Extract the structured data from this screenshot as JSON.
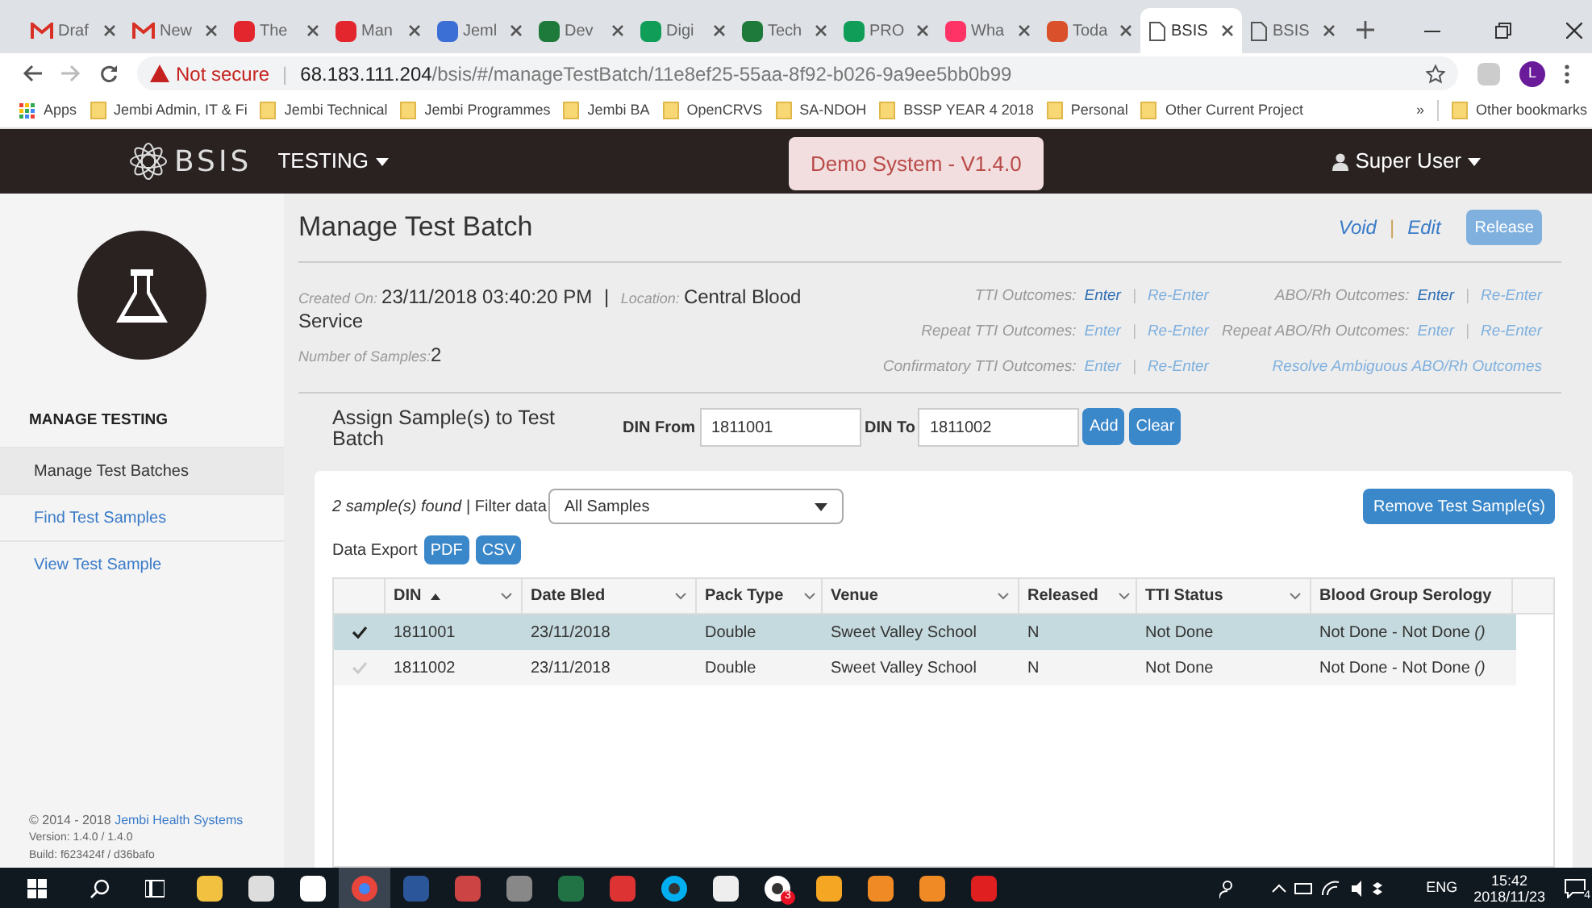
{
  "browser": {
    "tabs": [
      {
        "label": "Draf",
        "kind": "gmail",
        "selected": false
      },
      {
        "label": "New",
        "kind": "gmail",
        "selected": false
      },
      {
        "label": "The",
        "kind": "ag",
        "selected": false
      },
      {
        "label": "Man",
        "kind": "ag",
        "selected": false
      },
      {
        "label": "Jeml",
        "kind": "calendar",
        "selected": false
      },
      {
        "label": "Dev",
        "kind": "leaf",
        "selected": false
      },
      {
        "label": "Digi",
        "kind": "sheets",
        "selected": false
      },
      {
        "label": "Tech",
        "kind": "leaf",
        "selected": false
      },
      {
        "label": "PRO",
        "kind": "sheets",
        "selected": false
      },
      {
        "label": "Wha",
        "kind": "invision",
        "selected": false
      },
      {
        "label": "Toda",
        "kind": "todo",
        "selected": false
      },
      {
        "label": "BSIS",
        "kind": "page",
        "selected": true
      },
      {
        "label": "BSIS",
        "kind": "page",
        "selected": false
      }
    ],
    "address": {
      "warning": "Not secure",
      "separator": "|",
      "host": "68.183.111.204",
      "path": "/bsis/#/manageTestBatch/11e8ef25-55aa-8f92-b026-9a9ee5bb0b99"
    },
    "profile": "L",
    "bookmarks": [
      {
        "label": "Apps",
        "kind": "apps"
      },
      {
        "label": "Jembi Admin, IT & Fi",
        "kind": "folder"
      },
      {
        "label": "Jembi Technical",
        "kind": "folder"
      },
      {
        "label": "Jembi Programmes",
        "kind": "folder"
      },
      {
        "label": "Jembi BA",
        "kind": "folder"
      },
      {
        "label": "OpenCRVS",
        "kind": "folder"
      },
      {
        "label": "SA-NDOH",
        "kind": "folder"
      },
      {
        "label": "BSSP YEAR 4 2018",
        "kind": "folder"
      },
      {
        "label": "Personal",
        "kind": "folder"
      },
      {
        "label": "Other Current Project",
        "kind": "folder"
      }
    ],
    "bookmarks_more": "»",
    "other_bookmarks": "Other bookmarks"
  },
  "header": {
    "logo": "BSIS",
    "menu": "TESTING",
    "demo": "Demo System - V1.4.0",
    "user": "Super User"
  },
  "sidebar": {
    "section": "MANAGE TESTING",
    "items": [
      {
        "label": "Manage Test Batches",
        "selected": true
      },
      {
        "label": "Find Test Samples",
        "selected": false
      },
      {
        "label": "View Test Sample",
        "selected": false
      }
    ],
    "footer": {
      "copyright": "© 2014 - 2018",
      "company": "Jembi Health Systems",
      "version": "Version: 1.4.0 / 1.4.0",
      "build": "Build: f623424f / d36bafo"
    }
  },
  "page": {
    "title": "Manage Test Batch",
    "actions": {
      "void": "Void",
      "separator": "|",
      "edit": "Edit",
      "release": {
        "label": "Release",
        "disabled": true
      }
    },
    "meta": {
      "created_label": "Created On:",
      "created": "23/11/2018 03:40:20 PM",
      "separator": "|",
      "location_label": "Location:",
      "location": "Central Blood Service",
      "samples_label": "Number of Samples:",
      "samples": "2"
    },
    "outcomes": [
      {
        "label": "TTI Outcomes:",
        "separator": "|",
        "links": [
          {
            "label": "Enter",
            "enabled": true
          },
          {
            "label": "Re-Enter",
            "enabled": false
          }
        ]
      },
      {
        "label": "ABO/Rh Outcomes:",
        "separator": "|",
        "links": [
          {
            "label": "Enter",
            "enabled": true
          },
          {
            "label": "Re-Enter",
            "enabled": false
          }
        ]
      },
      {
        "label": "Repeat TTI Outcomes:",
        "separator": "|",
        "links": [
          {
            "label": "Enter",
            "enabled": false
          },
          {
            "label": "Re-Enter",
            "enabled": false
          }
        ]
      },
      {
        "label": "Repeat ABO/Rh Outcomes:",
        "separator": "|",
        "links": [
          {
            "label": "Enter",
            "enabled": false
          },
          {
            "label": "Re-Enter",
            "enabled": false
          }
        ]
      },
      {
        "label": "Confirmatory TTI Outcomes:",
        "separator": "|",
        "links": [
          {
            "label": "Enter",
            "enabled": false
          },
          {
            "label": "Re-Enter",
            "enabled": false
          }
        ]
      },
      {
        "links": [
          {
            "label": "Resolve Ambiguous ABO/Rh Outcomes",
            "enabled": false
          }
        ]
      }
    ],
    "assign": {
      "title": "Assign Sample(s) to Test Batch",
      "from_label": "DIN From",
      "from": "1811001",
      "to_label": "DIN To",
      "to": "1811002",
      "add": "Add",
      "clear": "Clear"
    },
    "results": {
      "found": "2 sample(s) found",
      "filter_label": "| Filter data",
      "filter": "All Samples",
      "remove": "Remove Test Sample(s)",
      "export_label": "Data Export",
      "exports": [
        "PDF",
        "CSV"
      ]
    },
    "table": {
      "columns": [
        {
          "label": "DIN",
          "sorted": true
        },
        {
          "label": "Date Bled",
          "sorted": false
        },
        {
          "label": "Pack Type",
          "sorted": false
        },
        {
          "label": "Venue",
          "sorted": false
        },
        {
          "label": "Released",
          "sorted": false
        },
        {
          "label": "TTI Status",
          "sorted": false
        },
        {
          "label": "Blood Group Serology",
          "sorted": false
        }
      ],
      "rows": [
        {
          "selected": true,
          "cells": [
            "1811001",
            "23/11/2018",
            "Double",
            "Sweet Valley School",
            "N",
            "Not Done",
            "Not Done - Not Done *()*"
          ]
        },
        {
          "selected": false,
          "cells": [
            "1811002",
            "23/11/2018",
            "Double",
            "Sweet Valley School",
            "N",
            "Not Done",
            "Not Done - Not Done *()*"
          ]
        }
      ]
    }
  },
  "taskbar": {
    "apps": [
      {
        "kind": "explorer",
        "active": false
      },
      {
        "kind": "calculator",
        "active": false
      },
      {
        "kind": "mail",
        "active": false
      },
      {
        "kind": "chrome",
        "active": true
      },
      {
        "kind": "word",
        "active": false
      },
      {
        "kind": "snip",
        "active": false
      },
      {
        "kind": "wps",
        "active": false
      },
      {
        "kind": "excel",
        "active": false
      },
      {
        "kind": "shield",
        "active": false
      },
      {
        "kind": "skype",
        "active": false
      },
      {
        "kind": "mic",
        "active": false
      },
      {
        "kind": "game",
        "active": false,
        "badge": "3"
      },
      {
        "kind": "store",
        "active": false
      },
      {
        "kind": "doc",
        "active": false
      },
      {
        "kind": "doc",
        "active": false
      },
      {
        "kind": "pdf",
        "active": false
      }
    ],
    "lang": "ENG",
    "time": "15:42",
    "date": "2018/11/23",
    "notifications": "4"
  }
}
